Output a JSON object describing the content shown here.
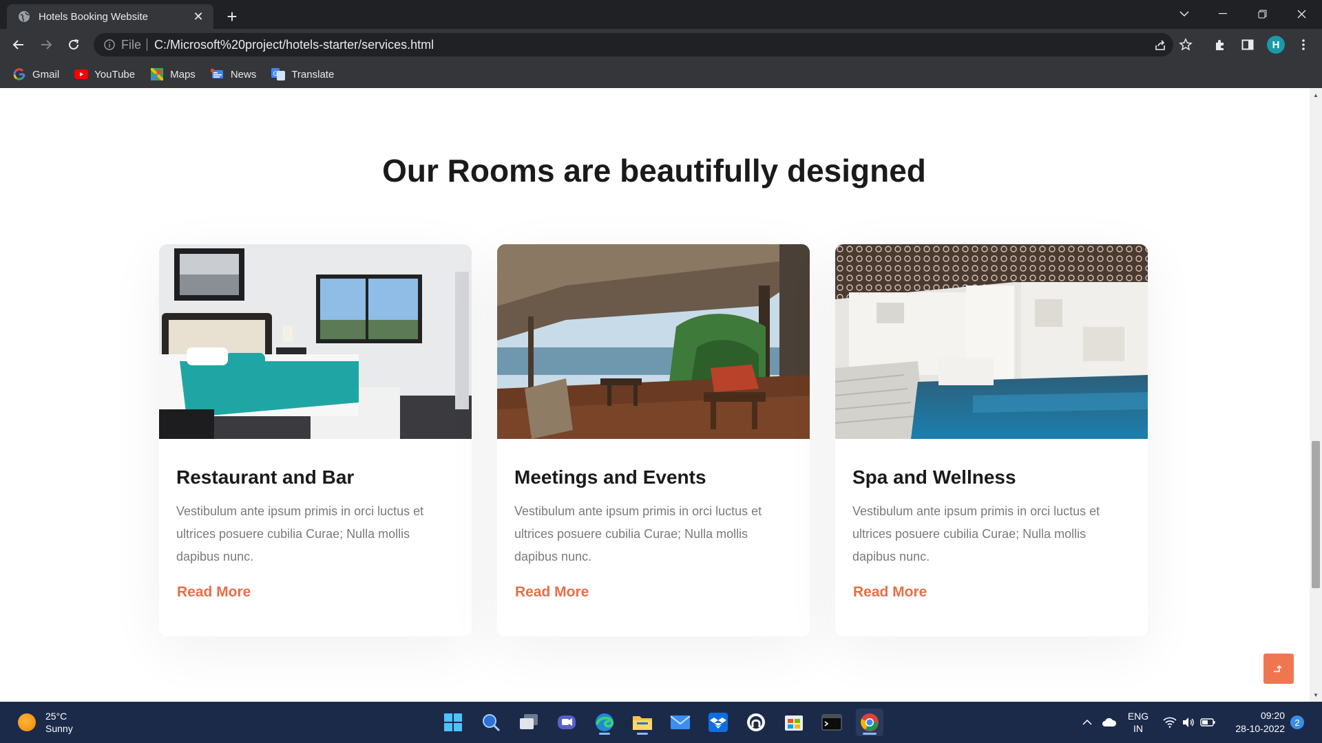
{
  "browser": {
    "tab_title": "Hotels Booking Website",
    "omnibox": {
      "scheme_label": "File",
      "url": "C:/Microsoft%20project/hotels-starter/services.html"
    },
    "profile_initial": "H",
    "bookmarks": [
      {
        "label": "Gmail",
        "icon": "google-icon"
      },
      {
        "label": "YouTube",
        "icon": "youtube-icon"
      },
      {
        "label": "Maps",
        "icon": "maps-icon"
      },
      {
        "label": "News",
        "icon": "news-icon"
      },
      {
        "label": "Translate",
        "icon": "translate-icon"
      }
    ]
  },
  "page": {
    "section_title": "Our Rooms are beautifully designed",
    "cards": [
      {
        "title": "Restaurant and Bar",
        "text": "Vestibulum ante ipsum primis in orci luctus et ultrices posuere cubilia Curae; Nulla mollis dapibus nunc.",
        "link": "Read More",
        "image": "bedroom-photo"
      },
      {
        "title": "Meetings and Events",
        "text": "Vestibulum ante ipsum primis in orci luctus et ultrices posuere cubilia Curae; Nulla mollis dapibus nunc.",
        "link": "Read More",
        "image": "beach-veranda-photo"
      },
      {
        "title": "Spa and Wellness",
        "text": "Vestibulum ante ipsum primis in orci luctus et ultrices posuere cubilia Curae; Nulla mollis dapibus nunc.",
        "link": "Read More",
        "image": "spa-pool-photo"
      }
    ],
    "accent_color": "#e86e47"
  },
  "taskbar": {
    "weather": {
      "temp": "25°C",
      "condition": "Sunny"
    },
    "language": {
      "line1": "ENG",
      "line2": "IN"
    },
    "clock": {
      "time": "09:20",
      "date": "28-10-2022"
    },
    "notifications": "2",
    "apps": [
      "start-icon",
      "search-icon",
      "task-view-icon",
      "teams-chat-icon",
      "edge-icon",
      "file-explorer-icon",
      "mail-icon",
      "dropbox-icon",
      "github-icon",
      "microsoft-store-icon",
      "terminal-icon",
      "chrome-icon"
    ]
  }
}
